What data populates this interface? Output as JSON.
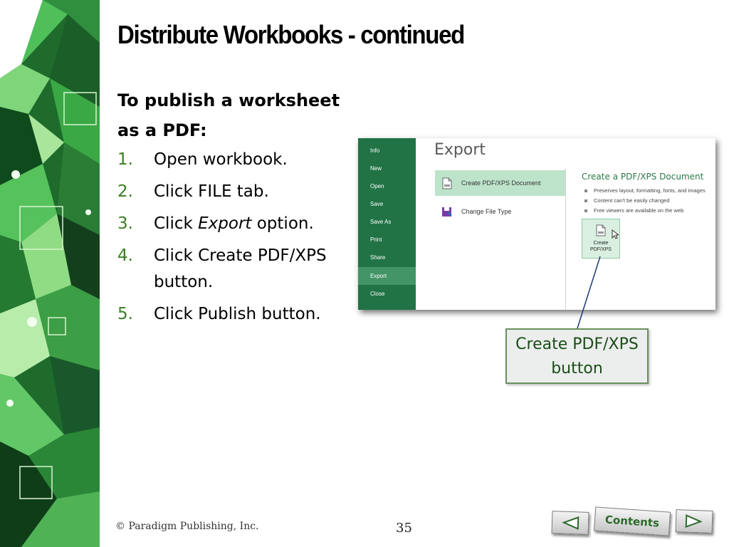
{
  "slide": {
    "title": "Distribute Workbooks - continued",
    "intro": "To publish a worksheet as a PDF:",
    "steps": [
      {
        "num": "1.",
        "text": "Open workbook."
      },
      {
        "num": "2.",
        "text": "Click FILE tab."
      },
      {
        "num": "3.",
        "pre": "Click ",
        "em": "Export",
        "post": " option."
      },
      {
        "num": "4.",
        "text": "Click Create PDF/XPS button."
      },
      {
        "num": "5.",
        "text": "Click Publish button."
      }
    ]
  },
  "screenshot": {
    "nav": [
      "Info",
      "New",
      "Open",
      "Save",
      "Save As",
      "Print",
      "Share",
      "Export",
      "Close"
    ],
    "active_nav": "Export",
    "heading": "Export",
    "options": [
      {
        "label": "Create PDF/XPS Document",
        "icon": "pdf-document-icon",
        "selected": true
      },
      {
        "label": "Change File Type",
        "icon": "change-file-type-icon",
        "selected": false
      }
    ],
    "pane_title": "Create a PDF/XPS Document",
    "pane_bullets": [
      "Preserves layout, formatting, fonts, and images",
      "Content can't be easily changed",
      "Free viewers are available on the web"
    ],
    "button_label_line1": "Create",
    "button_label_line2": "PDF/XPS"
  },
  "callout": {
    "line1": "Create PDF/XPS",
    "line2": "button"
  },
  "footer": {
    "copyright": "© Paradigm Publishing, Inc.",
    "page_number": "35",
    "contents_label": "Contents"
  },
  "colors": {
    "accent_green": "#3a7d22",
    "excel_green": "#217346",
    "selected_option": "#bde4cb"
  }
}
